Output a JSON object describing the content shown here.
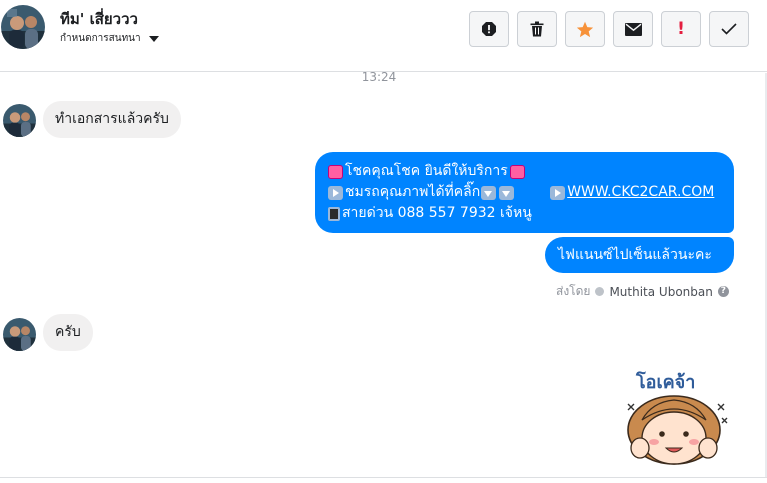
{
  "header": {
    "name": "ทีม' เสี่ยววว",
    "subtitle": "กำหนดการสนทนา"
  },
  "toolbar": {
    "buttons": [
      "spam-icon",
      "trash-icon",
      "star-icon",
      "envelope-icon",
      "important-icon",
      "check-icon"
    ],
    "accent": "#f7923a",
    "important_text": "!"
  },
  "conversation": {
    "timestamp": "13:24",
    "messages": [
      {
        "direction": "incoming",
        "text": "ทำเอกสารแล้วครับ"
      },
      {
        "direction": "outgoing",
        "lines": {
          "line1": "โชคคุณโชค ยินดีให้บริการ",
          "line2a": "ชมรถคุณภาพได้ที่คลิ๊ก",
          "line2b": "WWW.CKC2CAR.COM",
          "line3": "สายด่วน 088 557 7932 เจ้หนู"
        }
      },
      {
        "direction": "outgoing",
        "text": "ไฟแนนซ์ไปเซ็นแล้วนะคะ"
      },
      {
        "direction": "incoming",
        "text": "ครับ"
      }
    ],
    "sent_by_label": "ส่งโดย",
    "sent_by_name": "Muthita Ubonban",
    "help": "?",
    "sticker_text": "โอเคจ้า"
  },
  "colors": {
    "outgoing_bubble": "#0084ff",
    "incoming_bubble": "#f1f0f0"
  }
}
